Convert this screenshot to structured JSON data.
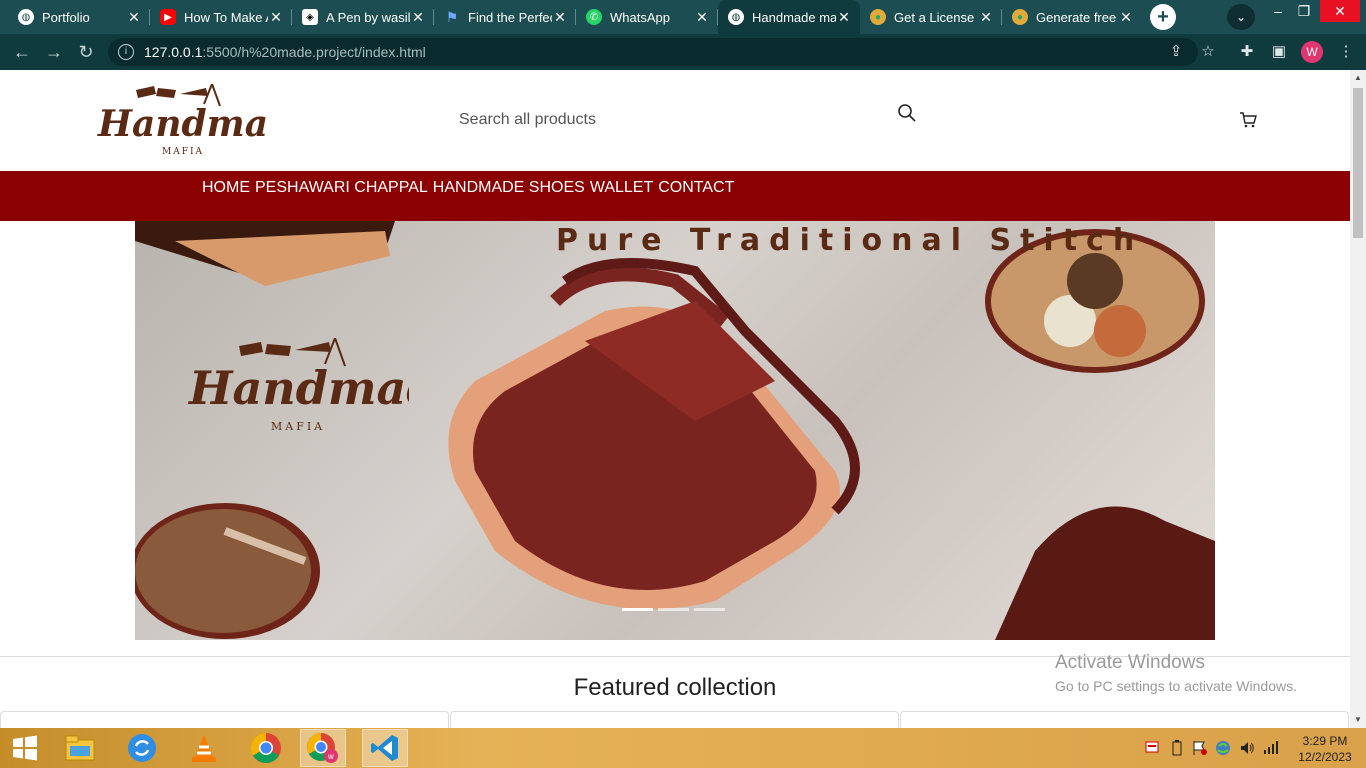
{
  "browser": {
    "tabs": [
      {
        "title": "Portfolio",
        "icon": "globe-icon"
      },
      {
        "title": "How To Make A",
        "icon": "youtube-icon"
      },
      {
        "title": "A Pen by wasil",
        "icon": "codepen-icon"
      },
      {
        "title": "Find the Perfect",
        "icon": "flag-icon"
      },
      {
        "title": "WhatsApp",
        "icon": "whatsapp-icon"
      },
      {
        "title": "Handmade ma",
        "icon": "globe-icon"
      },
      {
        "title": "Get a License",
        "icon": "earth-icon"
      },
      {
        "title": "Generate free",
        "icon": "earth-icon"
      }
    ],
    "active_tab_index": 5,
    "url_host": "127.0.0.1",
    "url_path": ":5500/h%20made.project/index.html",
    "profile_initial": "W"
  },
  "site": {
    "logo_text": "Handmade",
    "logo_sub": "MAFIA",
    "search_placeholder": "Search all products",
    "nav": [
      "HOME",
      "PESHAWARI CHAPPAL",
      "HANDMADE SHOES",
      "WALLET",
      "CONTACT"
    ],
    "hero_title": "Pure Traditional Stitch",
    "hero_slide_count": 3,
    "hero_active_slide": 1,
    "featured_heading": "Featured collection"
  },
  "watermark": {
    "line1": "Activate Windows",
    "line2": "Go to PC settings to activate Windows."
  },
  "taskbar": {
    "time": "3:29 PM",
    "date": "12/2/2023",
    "apps": [
      "start-icon",
      "file-explorer-icon",
      "sync-icon",
      "vlc-icon",
      "chrome-icon",
      "chrome-profile-icon",
      "vscode-icon"
    ]
  },
  "colors": {
    "tab_strip": "#1b4d52",
    "nav_bar": "#8b0000",
    "brand_brown": "#5a2a14"
  }
}
